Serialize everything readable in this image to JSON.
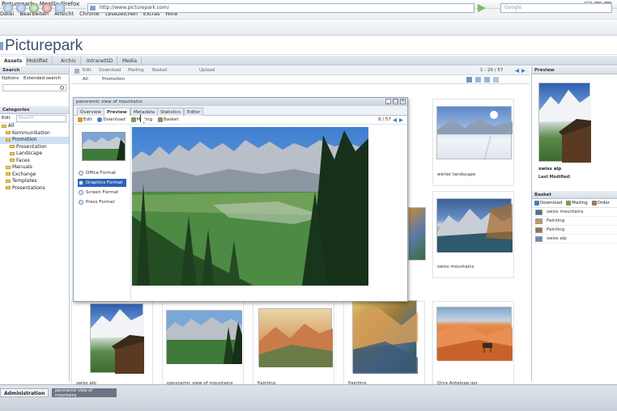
{
  "window": {
    "title": "Picturepark - Mozilla Firefox",
    "controls": [
      "_",
      "□",
      "×"
    ]
  },
  "menu": [
    "Datei",
    "Bearbeiten",
    "Ansicht",
    "Chronik",
    "Lesezeichen",
    "Extras",
    "Hilfe"
  ],
  "nav": {
    "url": "http://www.picturepark.com/",
    "search_placeholder": "Google"
  },
  "app": {
    "logo": "Picturepark"
  },
  "app_tabs": [
    "Assets",
    "Mobilfiet",
    "Archiv",
    "IntranetSD",
    "Media"
  ],
  "left": {
    "search_header": "Search",
    "search_options": [
      "Options",
      "Extended search"
    ],
    "categories_header": "Categories",
    "edit_label": "Edit",
    "search_placeholder": "Search",
    "tree": [
      {
        "label": "All",
        "level": 0
      },
      {
        "label": "Kommunikation",
        "level": 1
      },
      {
        "label": "Promotion",
        "level": 1,
        "selected": true
      },
      {
        "label": "Presentation",
        "level": 2
      },
      {
        "label": "Landscape",
        "level": 2
      },
      {
        "label": "Faces",
        "level": 2
      },
      {
        "label": "Manuals",
        "level": 1
      },
      {
        "label": "Exchange",
        "level": 1
      },
      {
        "label": "Templates",
        "level": 1
      },
      {
        "label": "Presentations",
        "level": 1
      }
    ]
  },
  "center": {
    "toolbar": [
      "Edit",
      "Download",
      "Mailing",
      "Basket",
      "Upload"
    ],
    "filter": [
      "All",
      "Promotion"
    ],
    "pager": "1 - 20 / 57",
    "tiles": [
      {
        "label": "winter landscape",
        "img": "winter"
      },
      {
        "label": "swiss mountains",
        "img": "mountains"
      },
      {
        "label": "swiss alp",
        "img": "alp"
      },
      {
        "label": "panoramic view of mountains",
        "img": "panorama"
      },
      {
        "label": "Painting",
        "img": "painting1"
      },
      {
        "label": "Painting",
        "img": "painting2"
      },
      {
        "label": "Oryx Antelope.jpg",
        "img": "desert"
      }
    ]
  },
  "dialog": {
    "title": "panoramic view of mountains",
    "tabs": [
      "Overview",
      "Preview",
      "Metadata",
      "Statistics",
      "Editor"
    ],
    "active_tab": "Preview",
    "toolbar": [
      "Edit",
      "Download",
      "Mailing",
      "Basket"
    ],
    "pager": "8 / 57",
    "formats": [
      "Office Format",
      "Graphics Format",
      "Screen Format",
      "Press Format"
    ],
    "active_format": "Graphics Format",
    "win_buttons": [
      "_",
      "□",
      "×"
    ]
  },
  "right": {
    "preview_header": "Preview",
    "preview_title": "swiss alp",
    "preview_meta": "Last Modified:",
    "basket_header": "Basket",
    "basket_toolbar": [
      "Download",
      "Mailing",
      "Order"
    ],
    "basket_items": [
      "swiss mountains",
      "Painting",
      "Painting",
      "swiss alp"
    ]
  },
  "taskbar": {
    "items": [
      "Administration",
      "panoramic view of mountains"
    ]
  },
  "colors": {
    "accent": "#2c63b8",
    "header": "#d6dde6",
    "logo": "#39506a"
  }
}
